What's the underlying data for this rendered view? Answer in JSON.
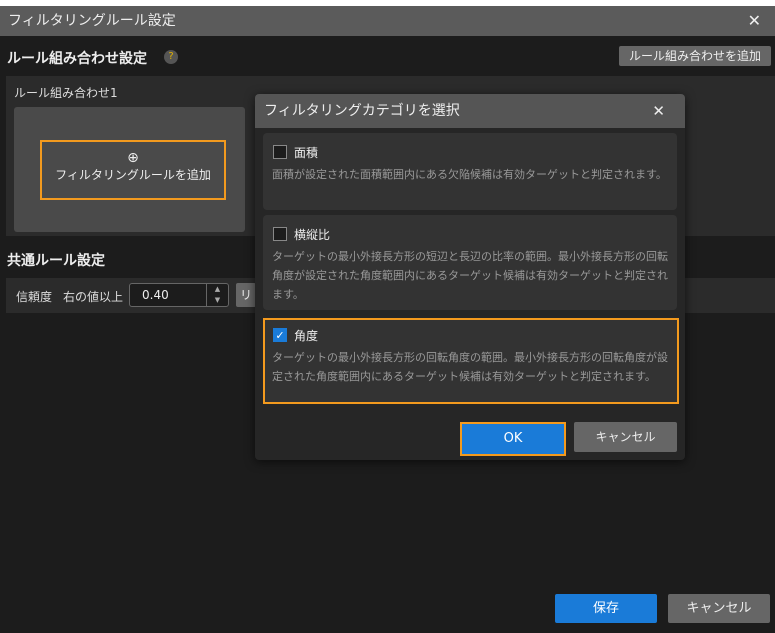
{
  "window": {
    "title": "フィルタリングルール設定",
    "close_icon": "close-icon"
  },
  "combo_section": {
    "title": "ルール組み合わせ設定",
    "help": "?",
    "add_button": "ルール組み合わせを追加",
    "combo_label": "ルール組み合わせ1",
    "add_rule": "フィルタリングルールを追加",
    "add_rule_icon": "⊕"
  },
  "common_section": {
    "title": "共通ルール設定",
    "confidence_label": "信頼度",
    "condition": "右の値以上",
    "value": "0.40",
    "partial_button": "リ"
  },
  "dialog": {
    "title": "フィルタリングカテゴリを選択",
    "categories": [
      {
        "name": "面積",
        "checked": false,
        "desc": "面積が設定された面積範囲内にある欠陥候補は有効ターゲットと判定されます。"
      },
      {
        "name": "横縦比",
        "checked": false,
        "desc": "ターゲットの最小外接長方形の短辺と長辺の比率の範囲。最小外接長方形の回転角度が設定された角度範囲内にあるターゲット候補は有効ターゲットと判定されます。"
      },
      {
        "name": "角度",
        "checked": true,
        "desc": "ターゲットの最小外接長方形の回転角度の範囲。最小外接長方形の回転角度が設定された角度範囲内にあるターゲット候補は有効ターゲットと判定されます。"
      }
    ],
    "ok": "OK",
    "cancel": "キャンセル"
  },
  "footer": {
    "save": "保存",
    "cancel": "キャンセル"
  },
  "colors": {
    "accent": "#1a7bd8",
    "highlight": "#f39a1e"
  }
}
